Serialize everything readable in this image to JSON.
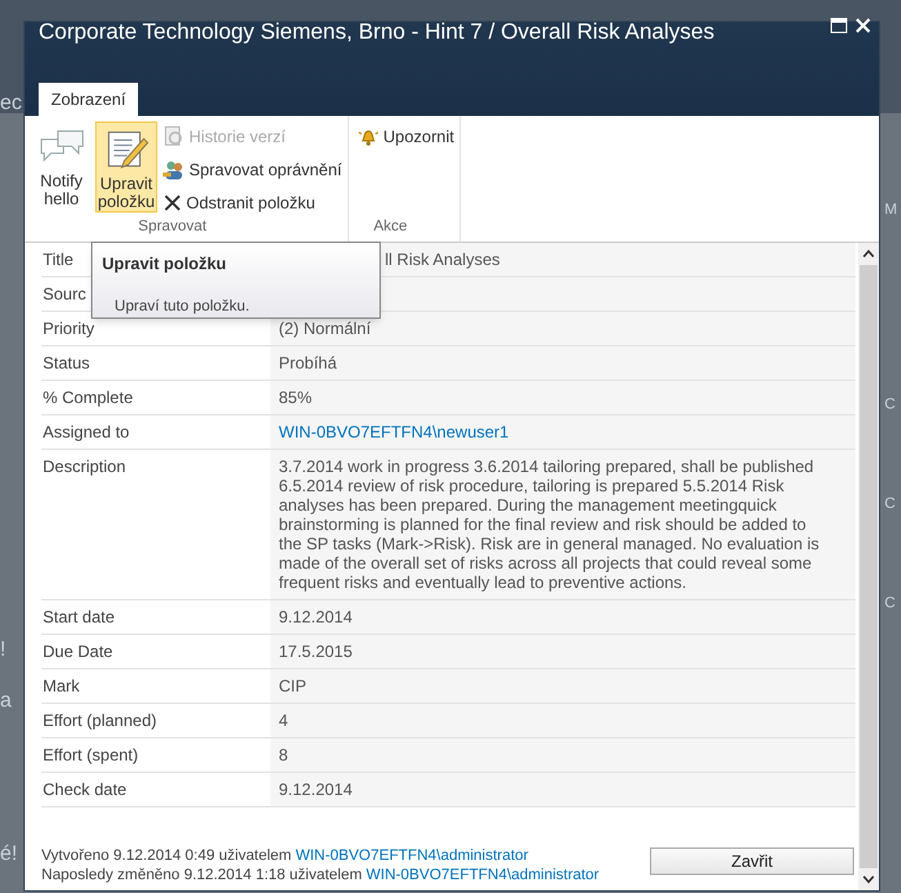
{
  "background": {
    "left_fragments": [
      "ec",
      "!",
      "a",
      "é!"
    ],
    "right_fragments": [
      "M",
      "C",
      "C",
      "C"
    ]
  },
  "window": {
    "title": "Corporate Technology Siemens, Brno - Hint 7 / Overall Risk Analyses"
  },
  "ribbon": {
    "tabs": [
      {
        "label": "Zobrazení",
        "selected": true
      }
    ],
    "groups": [
      {
        "label": "Spravovat",
        "large_buttons": [
          {
            "label": "Notify hello",
            "selected": false
          },
          {
            "label": "Upravit položku",
            "selected": true
          }
        ],
        "small_buttons": [
          {
            "label": "Historie verzí",
            "disabled": true
          },
          {
            "label": "Spravovat oprávnění",
            "disabled": false
          },
          {
            "label": "Odstranit položku",
            "disabled": false
          }
        ]
      },
      {
        "label": "Akce",
        "small_buttons": [
          {
            "label": "Upozornit",
            "disabled": false
          }
        ]
      }
    ]
  },
  "tooltip": {
    "title": "Upravit položku",
    "text": "Upraví tuto položku."
  },
  "fields": [
    {
      "label": "Title",
      "value": "ll Risk Analyses",
      "kind": "text"
    },
    {
      "label": "Sourc"
    },
    {
      "label": "Priority",
      "value": "(2) Normální",
      "kind": "text"
    },
    {
      "label": "Status",
      "value": "Probíhá",
      "kind": "text"
    },
    {
      "label": "% Complete",
      "value": "85%",
      "kind": "text"
    },
    {
      "label": "Assigned to",
      "value": "WIN-0BVO7EFTFN4\\newuser1",
      "kind": "link"
    },
    {
      "label": "Description",
      "value": "3.7.2014 work in progress 3.6.2014 tailoring prepared, shall be published 6.5.2014 review of risk procedure, tailoring is prepared 5.5.2014 Risk analyses has been prepared. During the management meetingquick brainstorming is planned for the final review and risk should be added to the SP tasks (Mark->Risk). Risk are in general managed. No evaluation is made of the overall set of risks across all projects that could reveal some frequent risks and eventually lead to preventive actions.",
      "kind": "text"
    },
    {
      "label": "Start date",
      "value": "9.12.2014",
      "kind": "text"
    },
    {
      "label": "Due Date",
      "value": "17.5.2015",
      "kind": "text"
    },
    {
      "label": "Mark",
      "value": "CIP",
      "kind": "text"
    },
    {
      "label": "Effort (planned)",
      "value": "4",
      "kind": "text"
    },
    {
      "label": "Effort (spent)",
      "value": "8",
      "kind": "text"
    },
    {
      "label": "Check date",
      "value": "9.12.2014",
      "kind": "text"
    }
  ],
  "footer": {
    "lines": [
      {
        "text": "Vytvořeno 9.12.2014 0:49 uživatelem",
        "link": "WIN-0BVO7EFTFN4\\administrator"
      },
      {
        "text": "Naposledy změněno 9.12.2014 1:18 uživatelem",
        "link": "WIN-0BVO7EFTFN4\\administrator"
      }
    ],
    "button": "Zavřit"
  }
}
